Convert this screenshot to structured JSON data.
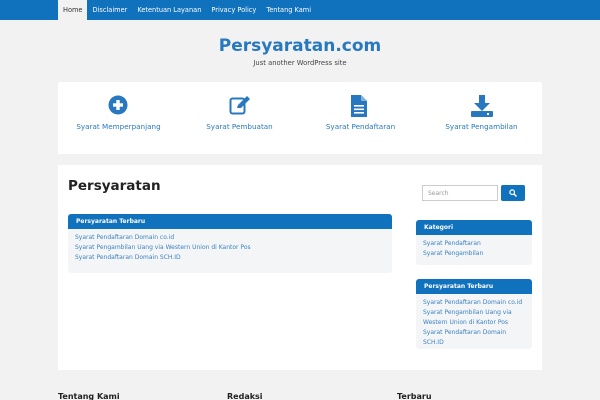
{
  "nav": {
    "items": [
      {
        "label": "Home"
      },
      {
        "label": "Disclaimer"
      },
      {
        "label": "Ketentuan Layanan"
      },
      {
        "label": "Privacy Policy"
      },
      {
        "label": "Tentang Kami"
      }
    ]
  },
  "site": {
    "title": "Persyaratan.com",
    "tagline": "Just another WordPress site"
  },
  "features": [
    {
      "label": "Syarat Memperpanjang",
      "icon": "plus-circle-icon"
    },
    {
      "label": "Syarat Pembuatan",
      "icon": "edit-icon"
    },
    {
      "label": "Syarat Pendaftaran",
      "icon": "document-icon"
    },
    {
      "label": "Syarat Pengambilan",
      "icon": "download-icon"
    }
  ],
  "main": {
    "title": "Persyaratan",
    "recent_box": {
      "heading": "Persyaratan Terbaru",
      "items": [
        "Syarat Pendaftaran Domain co.id",
        "Syarat Pengambilan Uang via Western Union di Kantor Pos",
        "Syarat Pendaftaran Domain SCH.ID"
      ]
    }
  },
  "sidebar": {
    "search": {
      "placeholder": "Search",
      "button_icon": "search-icon"
    },
    "kategori": {
      "heading": "Kategori",
      "items": [
        "Syarat Pendaftaran",
        "Syarat Pengambilan"
      ]
    },
    "recent": {
      "heading": "Persyaratan Terbaru",
      "items": [
        "Syarat Pendaftaran Domain co.id",
        "Syarat Pengambilan Uang via",
        "Western Union di Kantor Pos",
        "Syarat Pendaftaran Domain SCH.ID"
      ]
    }
  },
  "footer": {
    "headings": [
      "Tentang Kami",
      "Redaksi",
      "Terbaru"
    ]
  },
  "colors": {
    "primary": "#1071bc",
    "link": "#2878bf",
    "background": "#f2f2f2"
  }
}
